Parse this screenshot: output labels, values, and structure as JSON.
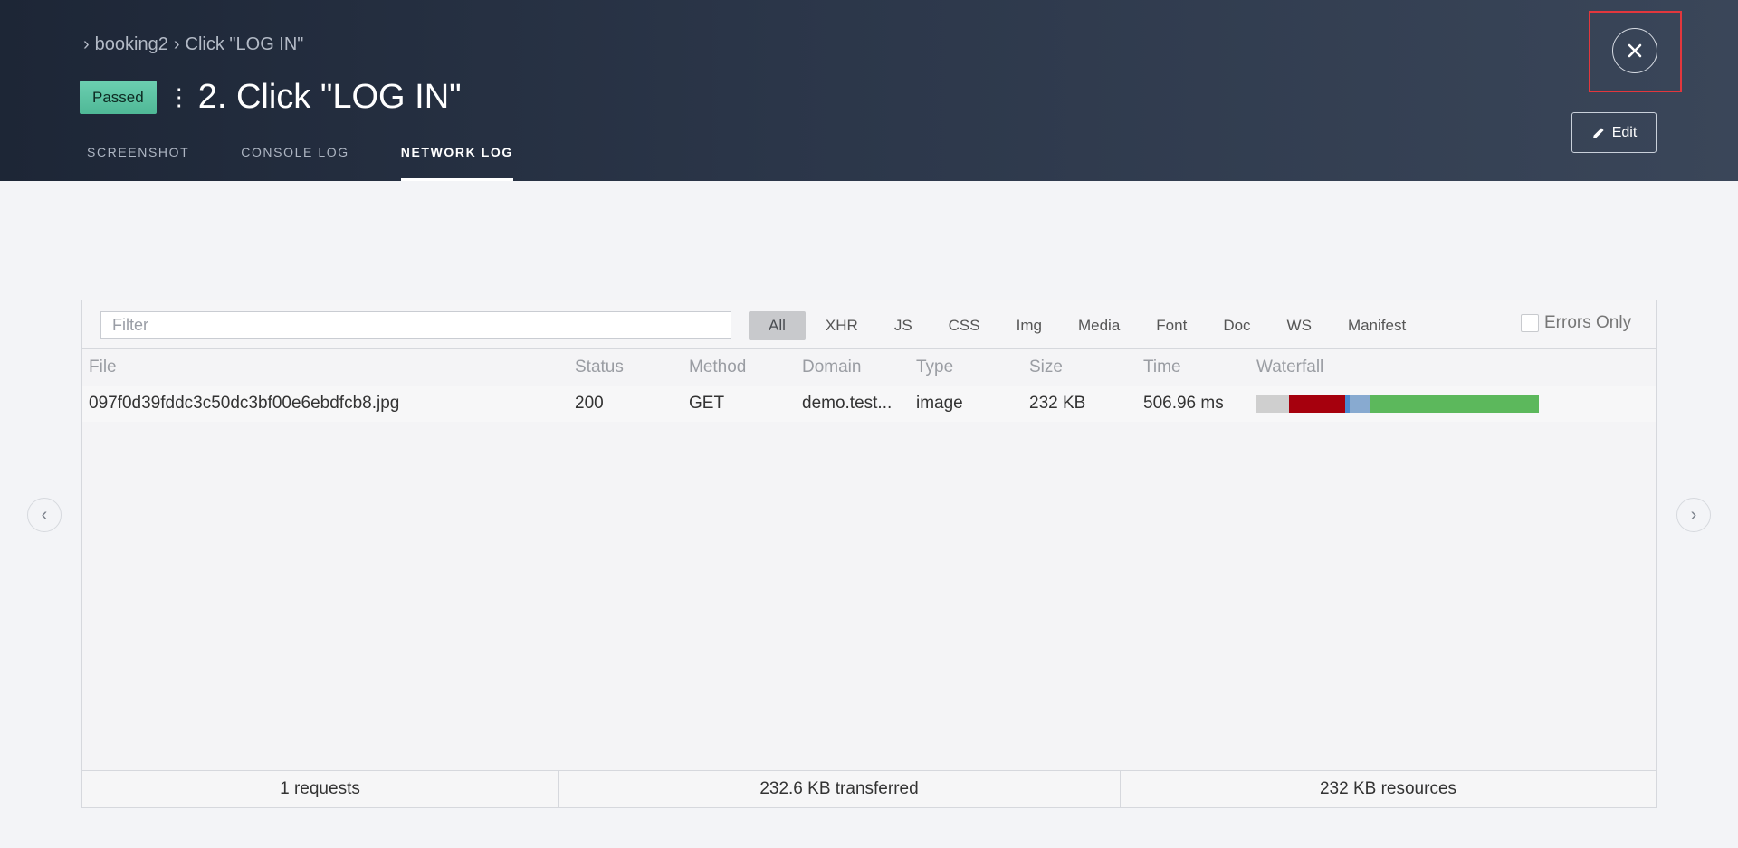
{
  "breadcrumb": {
    "items": [
      "booking2",
      "Click \"LOG IN\""
    ]
  },
  "step": {
    "status": "Passed",
    "title": "2. Click \"LOG IN\""
  },
  "tabs": [
    {
      "label": "SCREENSHOT"
    },
    {
      "label": "CONSOLE LOG"
    },
    {
      "label": "NETWORK LOG",
      "active": true
    }
  ],
  "actions": {
    "edit_label": "Edit",
    "close_icon": "close-icon"
  },
  "network": {
    "filter_placeholder": "Filter",
    "type_filters": [
      "All",
      "XHR",
      "JS",
      "CSS",
      "Img",
      "Media",
      "Font",
      "Doc",
      "WS",
      "Manifest"
    ],
    "active_filter": "All",
    "errors_only_label": "Errors Only",
    "columns": [
      "File",
      "Status",
      "Method",
      "Domain",
      "Type",
      "Size",
      "Time",
      "Waterfall"
    ],
    "rows": [
      {
        "file": "097f0d39fddc3c50dc3bf00e6ebdfcb8.jpg",
        "status": "200",
        "method": "GET",
        "domain": "demo.test...",
        "type": "image",
        "size": "232 KB",
        "time": "506.96 ms",
        "waterfall_colors": [
          "#cfcfcf",
          "#a6000d",
          "#4a88d0",
          "#88aad0",
          "#5cb85c"
        ]
      }
    ],
    "summary": {
      "requests": "1 requests",
      "transferred": "232.6 KB transferred",
      "resources": "232 KB resources"
    }
  },
  "colors": {
    "passed_badge": "#5cc3a6",
    "highlight_frame": "#e2373d"
  }
}
